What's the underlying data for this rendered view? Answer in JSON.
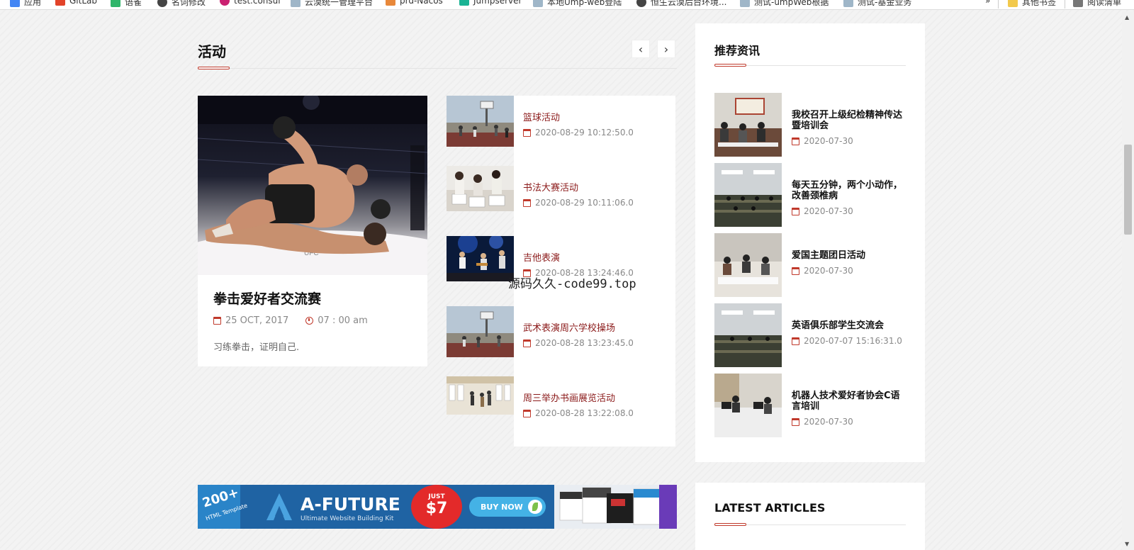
{
  "bookmarks": [
    {
      "label": "应用",
      "icon": "apps-grid-icon",
      "color": "#4285f4"
    },
    {
      "label": "GitLab",
      "icon": "gitlab-icon",
      "color": "#e24329"
    },
    {
      "label": "语雀",
      "icon": "yuque-icon",
      "color": "#2fb56a"
    },
    {
      "label": "名词修改",
      "icon": "globe-icon",
      "color": "#444444"
    },
    {
      "label": "test.consul",
      "icon": "consul-icon",
      "color": "#ca2171"
    },
    {
      "label": "云漠统一管理平台",
      "icon": "page-icon",
      "color": "#9fb6c8"
    },
    {
      "label": "prd-Nacos",
      "icon": "nacos-icon",
      "color": "#e8883a"
    },
    {
      "label": "Jumpserver",
      "icon": "jumpserver-icon",
      "color": "#1ab394"
    },
    {
      "label": "本地Ump-web登陆",
      "icon": "page-icon",
      "color": "#9fb6c8"
    },
    {
      "label": "恒生云漠后台环境...",
      "icon": "globe-icon",
      "color": "#444444"
    },
    {
      "label": "测试-umpWeb根据",
      "icon": "page-icon",
      "color": "#9fb6c8"
    },
    {
      "label": "测试-基金业务",
      "icon": "page-icon",
      "color": "#9fb6c8"
    }
  ],
  "bookmarks_right": {
    "more": "»",
    "other": "其他书签",
    "reading": "阅读清单"
  },
  "activity": {
    "title": "活动",
    "prev": "‹",
    "next": "›",
    "featured": {
      "title": "拳击爱好者交流赛",
      "date": "25 OCT, 2017",
      "time": "07 : 00 am",
      "excerpt": "习练拳击，证明自己."
    },
    "items": [
      {
        "title": "篮球活动",
        "date": "2020-08-29 10:12:50.0"
      },
      {
        "title": "书法大赛活动",
        "date": "2020-08-29 10:11:06.0"
      },
      {
        "title": "吉他表演",
        "date": "2020-08-28 13:24:46.0"
      },
      {
        "title": "武术表演周六学校操场",
        "date": "2020-08-28 13:23:45.0"
      },
      {
        "title": "周三举办书画展览活动",
        "date": "2020-08-28 13:22:08.0"
      }
    ]
  },
  "watermark": "源码久久-code99.top",
  "recommended": {
    "title": "推荐资讯",
    "items": [
      {
        "title": "我校召开上级纪检精神传达暨培训会",
        "date": "2020-07-30"
      },
      {
        "title": "每天五分钟，两个小动作，改善颈椎病",
        "date": "2020-07-30"
      },
      {
        "title": "爱国主题团日活动",
        "date": "2020-07-30"
      },
      {
        "title": "英语俱乐部学生交流会",
        "date": "2020-07-07 15:16:31.0"
      },
      {
        "title": "机器人技术爱好者协会C语言培训",
        "date": "2020-07-30"
      }
    ]
  },
  "banner": {
    "badge": "200+",
    "badge_sub": "HTML Template",
    "title": "A-FUTURE",
    "tagline": "Ultimate Website Building Kit",
    "price_prefix": "JUST",
    "price": "$7",
    "cta": "BUY NOW"
  },
  "latest": {
    "title": "LATEST ARTICLES"
  },
  "colors": {
    "accent": "#c0392b",
    "item_title": "#8b1a1a",
    "meta": "#888888"
  }
}
